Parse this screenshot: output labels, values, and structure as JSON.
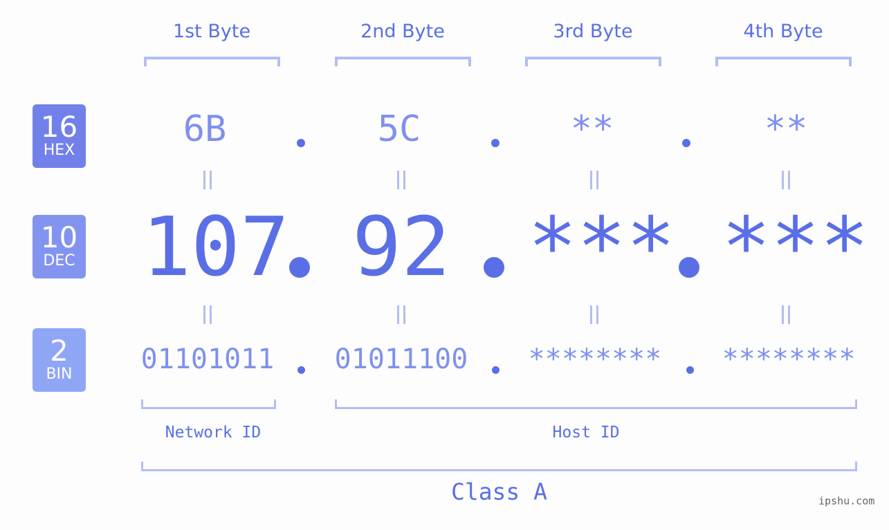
{
  "headers": [
    "1st Byte",
    "2nd Byte",
    "3rd Byte",
    "4th Byte"
  ],
  "badges": {
    "hex": {
      "number": "16",
      "label": "HEX",
      "color": "#7280ea"
    },
    "dec": {
      "number": "10",
      "label": "DEC",
      "color": "#8393f0"
    },
    "bin": {
      "number": "2",
      "label": "BIN",
      "color": "#8fa6f7"
    }
  },
  "hex": [
    "6B",
    "5C",
    "**",
    "**"
  ],
  "dec": [
    "107",
    "92",
    "***",
    "***"
  ],
  "bin": [
    "01101011",
    "01011100",
    "********",
    "********"
  ],
  "labels": {
    "network_id": "Network ID",
    "host_id": "Host ID",
    "class": "Class A"
  },
  "watermark": "ipshu.com",
  "colors": {
    "accent": "#5a6fe6",
    "light": "#8090ee",
    "bracket": "#b3bdf5"
  }
}
